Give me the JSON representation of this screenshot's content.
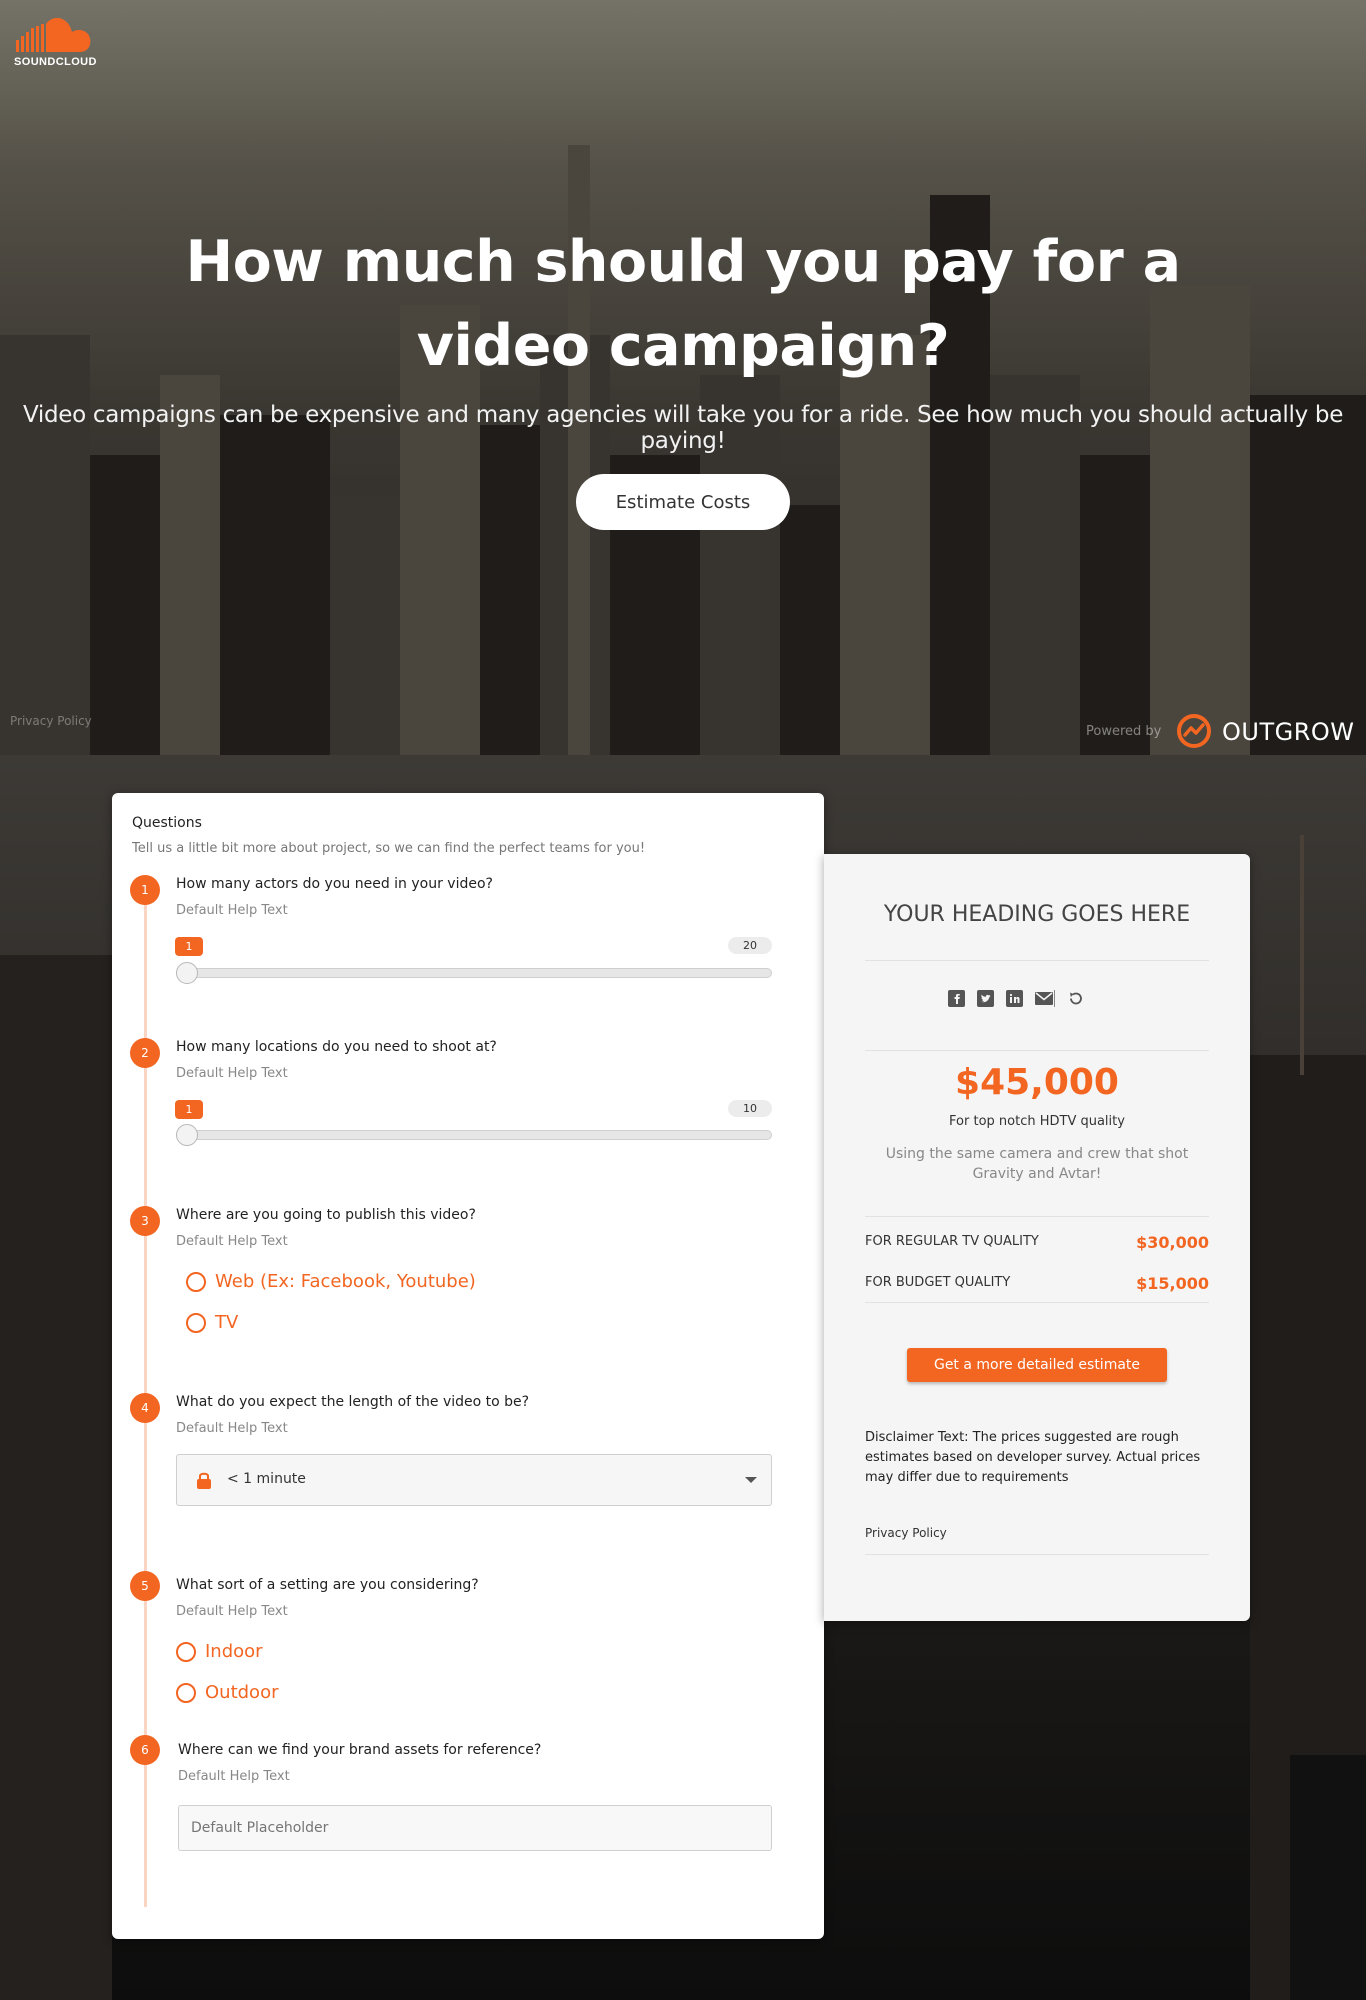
{
  "brand": {
    "name": "SOUNDCLOUD",
    "accent": "#f26622"
  },
  "hero": {
    "title": "How much should you pay for a video campaign?",
    "subtitle": "Video campaigns can be expensive and many agencies will take you for a ride. See how much you should actually be paying!",
    "cta_label": "Estimate Costs",
    "privacy_label": "Privacy Policy",
    "powered_by": "Powered by",
    "powered_brand": "OUTGROW"
  },
  "questions": {
    "title": "Questions",
    "description": "Tell us a little bit more about project, so we can find the perfect teams for you!",
    "items": [
      {
        "num": "1",
        "text": "How many actors do you need in your video?",
        "help": "Default Help Text",
        "min": "1",
        "max": "20"
      },
      {
        "num": "2",
        "text": "How many locations do you need to shoot at?",
        "help": "Default Help Text",
        "min": "1",
        "max": "10"
      },
      {
        "num": "3",
        "text": "Where are you going to publish this video?",
        "help": "Default Help Text",
        "options": [
          "Web (Ex: Facebook, Youtube)",
          "TV"
        ]
      },
      {
        "num": "4",
        "text": "What do you expect the length of the video to be?",
        "help": "Default Help Text",
        "selected": "< 1 minute"
      },
      {
        "num": "5",
        "text": "What sort of a setting are you considering?",
        "help": "Default Help Text",
        "options": [
          "Indoor",
          "Outdoor"
        ]
      },
      {
        "num": "6",
        "text": "Where can we find your brand assets for reference?",
        "help": "Default Help Text",
        "placeholder": "Default Placeholder"
      }
    ]
  },
  "result": {
    "heading": "YOUR HEADING GOES HERE",
    "share_icons": [
      "facebook-icon",
      "twitter-icon",
      "linkedin-icon",
      "email-icon",
      "reload-icon"
    ],
    "price": "$45,000",
    "price_label": "For top notch HDTV quality",
    "price_desc": "Using the same camera and crew that shot Gravity and Avtar!",
    "rows": [
      {
        "label": "FOR REGULAR TV QUALITY",
        "value": "$30,000"
      },
      {
        "label": "FOR BUDGET QUALITY",
        "value": "$15,000"
      }
    ],
    "cta_label": "Get a more detailed estimate",
    "disclaimer": "Disclaimer Text: The prices suggested are rough estimates based on developer survey. Actual prices may differ due to requirements",
    "privacy_label": "Privacy Policy"
  }
}
